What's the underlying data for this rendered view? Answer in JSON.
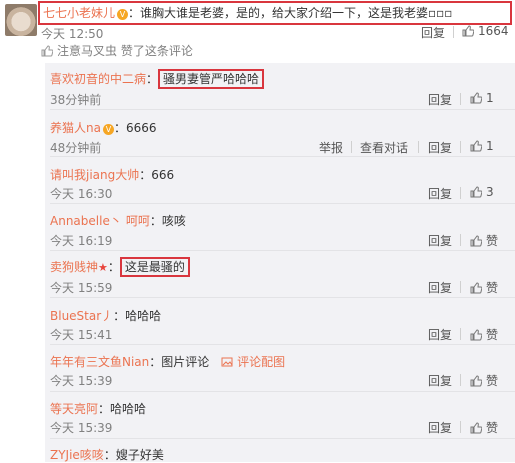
{
  "main_comment": {
    "username": "七七小老妹儿",
    "text": "：谁胸大谁是老婆，是的，给大家介绍一下，这是我老婆▫▫▫",
    "time": "今天 12:50",
    "reply_label": "回复",
    "like_count": "1664",
    "liked_by": "注意马叉虫 赞了这条评论"
  },
  "replies": [
    {
      "username": "喜欢初音的中二病",
      "text": "骚男妻管严哈哈哈",
      "time": "38分钟前",
      "reply_label": "回复",
      "like": "1",
      "highlight": true
    },
    {
      "username": "养猫人na",
      "text": "：6666",
      "time": "48分钟前",
      "report_label": "举报",
      "dialog_label": "查看对话",
      "reply_label": "回复",
      "like": "1",
      "vip": true
    },
    {
      "username": "请叫我jiang大帅",
      "text": "：666",
      "time": "今天 16:30",
      "reply_label": "回复",
      "like": "3"
    },
    {
      "username": "Annabelle丶",
      "mention": "呵呵",
      "text": "：咳咳",
      "time": "今天 16:19",
      "reply_label": "回复",
      "like": "赞"
    },
    {
      "username": "卖狗贱神",
      "text": "这是最骚的",
      "time": "今天 15:59",
      "reply_label": "回复",
      "like": "赞",
      "highlight": true
    },
    {
      "username": "BlueStar丿",
      "text": "：哈哈哈",
      "time": "今天 15:41",
      "reply_label": "回复",
      "like": "赞"
    },
    {
      "username": "年年有三文鱼Nian",
      "text": "：图片评论",
      "pic_label": "评论配图",
      "time": "今天 15:39",
      "reply_label": "回复",
      "like": "赞"
    },
    {
      "username": "等天亮阿",
      "text": "：哈哈哈",
      "time": "今天 15:39",
      "reply_label": "回复",
      "like": "赞"
    },
    {
      "username": "ZYJie咳咳",
      "text": "：嫂子好美"
    }
  ],
  "icons": {
    "thumb": "thumbs-up-icon",
    "like_small": "like-icon",
    "vip": "vip-badge-icon",
    "star": "star-icon",
    "image": "image-icon"
  },
  "colors": {
    "username": "#eb7350",
    "highlight_border": "#d9363e",
    "panel_bg": "#f2f2f5"
  }
}
